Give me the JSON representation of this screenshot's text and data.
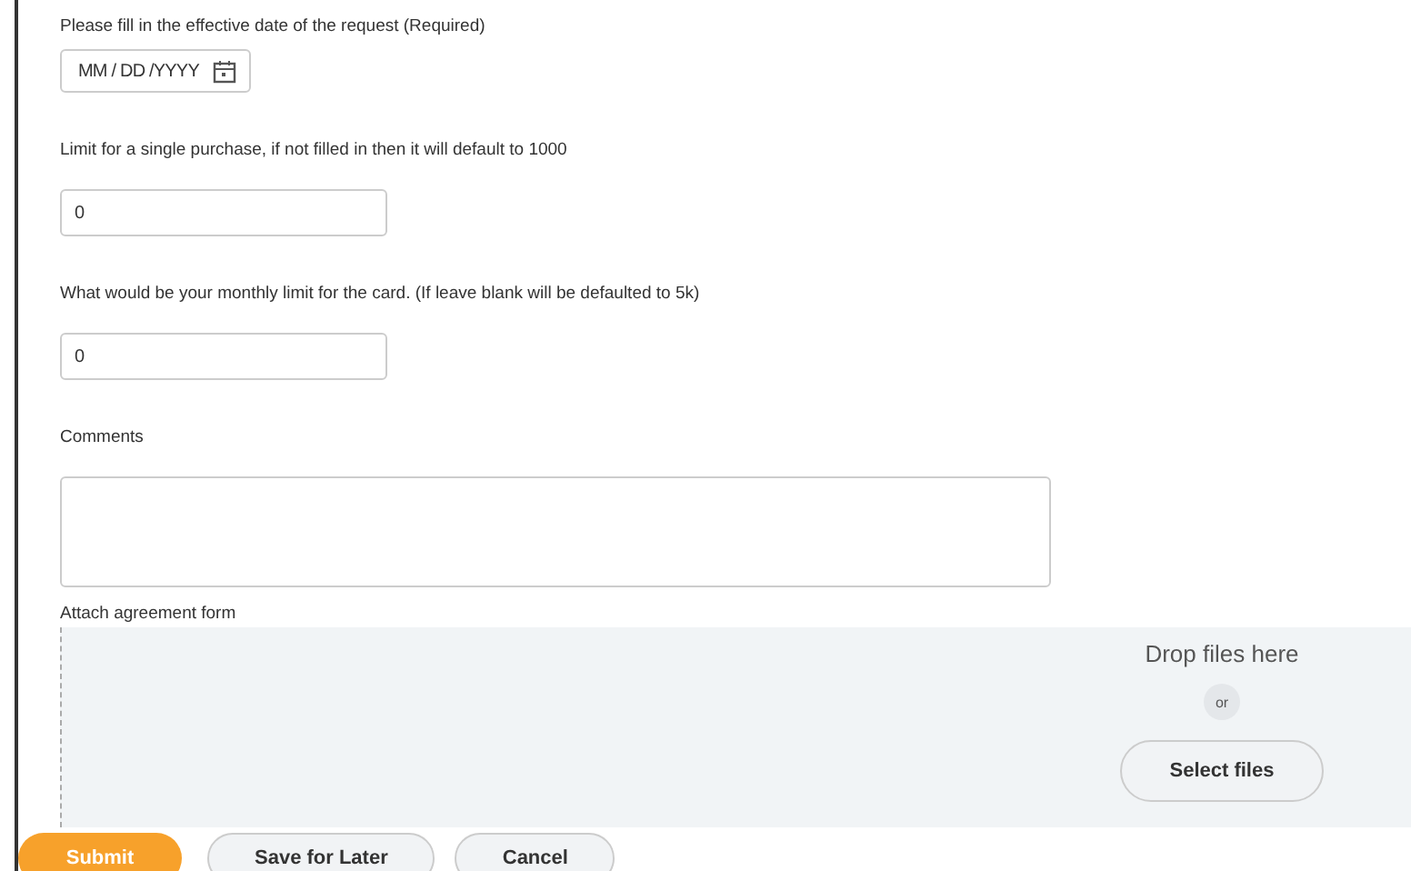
{
  "fields": [
    {
      "kind": "date",
      "label": "Please fill in the effective date of the request (Required)",
      "placeholder": "MM / DD /YYYY"
    },
    {
      "kind": "text",
      "label": "Limit for a single purchase, if not filled in then it will default to 1000",
      "value": "0"
    },
    {
      "kind": "text",
      "label": "What would be your monthly limit for the card. (If leave blank will be defaulted to 5k)",
      "value": "0"
    },
    {
      "kind": "textarea",
      "label": "Comments"
    },
    {
      "kind": "files",
      "label": "Attach agreement form",
      "drop_text": "Drop files here",
      "or_text": "or",
      "button": "Select files"
    }
  ],
  "buttons": [
    {
      "kind": "primary",
      "label": "Submit"
    },
    {
      "kind": "secondary",
      "label": "Save for Later"
    },
    {
      "kind": "secondary",
      "label": "Cancel"
    }
  ]
}
